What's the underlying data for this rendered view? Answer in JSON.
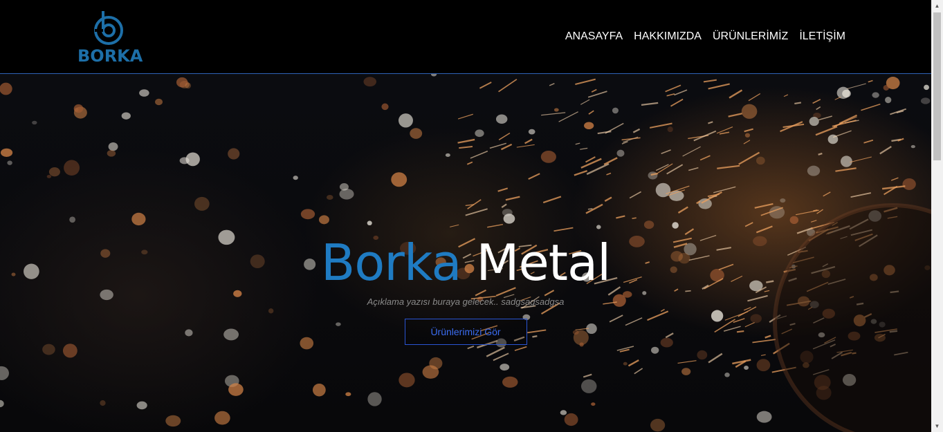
{
  "brand": {
    "name": "BORKA",
    "color": "#1d6fa8"
  },
  "nav": {
    "items": [
      "ANASAYFA",
      "HAKKIMIZDA",
      "ÜRÜNLERİMİZ",
      "İLETİŞİM"
    ]
  },
  "hero": {
    "title_part1": "Borka",
    "title_part2": "Metal",
    "subtitle": "Açıklama yazısı buraya gelecek.. sadgsagsadgsa",
    "button_label": "Ürünlerimizi Gör",
    "accent_color": "#1f7bc2",
    "button_color": "#2a55d4",
    "background": "welding sparks photo"
  },
  "scrollbar": {
    "up_icon": "▲",
    "down_icon": "▼"
  }
}
